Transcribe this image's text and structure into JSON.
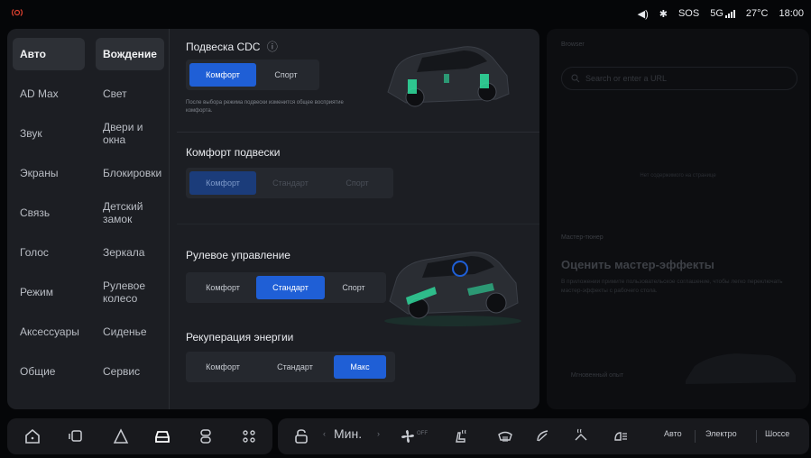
{
  "statusbar": {
    "volume": "◀)",
    "bluetooth": "✱",
    "sos": "SOS",
    "network": "5G",
    "temperature": "27°C",
    "time": "18:00"
  },
  "nav_primary": [
    {
      "label": "Авто",
      "active": true
    },
    {
      "label": "AD Max",
      "active": false
    },
    {
      "label": "Звук",
      "active": false
    },
    {
      "label": "Экраны",
      "active": false
    },
    {
      "label": "Связь",
      "active": false
    },
    {
      "label": "Голос",
      "active": false
    },
    {
      "label": "Режим",
      "active": false
    },
    {
      "label": "Аксессуары",
      "active": false
    },
    {
      "label": "Общие",
      "active": false
    }
  ],
  "nav_secondary": [
    {
      "label": "Вождение",
      "active": true
    },
    {
      "label": "Свет",
      "active": false
    },
    {
      "label": "Двери и окна",
      "active": false
    },
    {
      "label": "Блокировки",
      "active": false
    },
    {
      "label": "Детский замок",
      "active": false
    },
    {
      "label": "Зеркала",
      "active": false
    },
    {
      "label": "Рулевое колесо",
      "active": false
    },
    {
      "label": "Сиденье",
      "active": false
    },
    {
      "label": "Сервис",
      "active": false
    }
  ],
  "settings": {
    "cdc": {
      "title": "Подвеска CDC",
      "info_icon": "ⓘ",
      "options": [
        "Комфорт",
        "Спорт"
      ],
      "selected": "Комфорт",
      "note": "После выбора режима подвески изменится общее восприятие комфорта."
    },
    "suspension_comfort": {
      "title": "Комфорт подвески",
      "options": [
        "Комфорт",
        "Стандарт",
        "Спорт"
      ],
      "selected": "Комфорт"
    },
    "steering": {
      "title": "Рулевое управление",
      "options": [
        "Комфорт",
        "Стандарт",
        "Спорт"
      ],
      "selected": "Стандарт"
    },
    "regen": {
      "title": "Рекуперация энергии",
      "options": [
        "Комфорт",
        "Стандарт",
        "Макс"
      ],
      "selected": "Макс"
    }
  },
  "right_panel": {
    "browser_label": "Browser",
    "search_placeholder": "Search or enter a URL",
    "no_content": "Нет содержимого на странице",
    "master_label": "Мастер-тюнер",
    "master_title": "Оценить мастер-эффекты",
    "master_desc": "В приложении примите пользовательское соглашение, чтобы легко переключать мастер-эффекты с рабочего стола.",
    "instant_experience": "Мгновенный опыт"
  },
  "dock": {
    "fan_speed": "Мин.",
    "fan_off": "OFF",
    "modes": [
      "Авто",
      "Электро",
      "Шоссе"
    ]
  },
  "colors": {
    "accent": "#1f5fd6",
    "panel_bg": "#1c1e23",
    "record_red": "#e0412f",
    "car_highlight": "#2fe0a0"
  }
}
